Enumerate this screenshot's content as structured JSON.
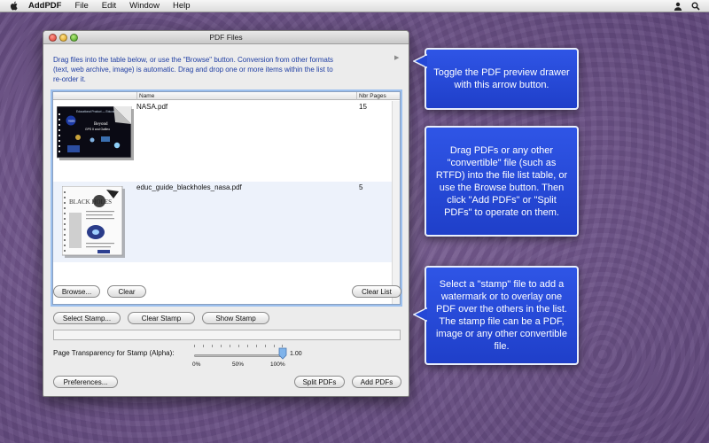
{
  "menubar": {
    "app_name": "AddPDF",
    "items": [
      "File",
      "Edit",
      "Window",
      "Help"
    ]
  },
  "window": {
    "title": "PDF Files",
    "instructions": "Drag files into the table below, or use the \"Browse\" button. Conversion from other formats (text, web archive, image) is automatic. Drag and drop one or more items within the list to re-order it.",
    "table": {
      "col_name": "Name",
      "col_pages": "Nbr Pages",
      "rows": [
        {
          "name": "NASA.pdf",
          "pages": "15"
        },
        {
          "name": "educ_guide_blackholes_nasa.pdf",
          "pages": "5"
        }
      ]
    },
    "buttons": {
      "browse": "Browse...",
      "clear": "Clear",
      "clear_list": "Clear List",
      "select_stamp": "Select Stamp...",
      "clear_stamp": "Clear Stamp",
      "show_stamp": "Show Stamp",
      "preferences": "Preferences...",
      "split_pdfs": "Split PDFs",
      "add_pdfs": "Add PDFs"
    },
    "stamp_alpha": {
      "label": "Page Transparency for Stamp (Alpha):",
      "value": "1.00",
      "level": 1.0,
      "tick_labels": [
        "0%",
        "50%",
        "100%"
      ]
    }
  },
  "callouts": {
    "preview": "Toggle the PDF preview drawer with this arrow button.",
    "drag": "Drag PDFs or any other \"convertible\"  file (such as RTFD) into the file list table, or use the Browse button. Then click \"Add PDFs\" or \"Split PDFs\" to operate on them.",
    "stamp": "Select a \"stamp\" file to add a watermark or to overlay one PDF over the others in the list. The stamp file can be a PDF, image or any other convertible file."
  },
  "colors": {
    "callout_blue": "#2447d6",
    "instruction_text": "#1f3ea3",
    "selected_row": "#edf2fb"
  }
}
